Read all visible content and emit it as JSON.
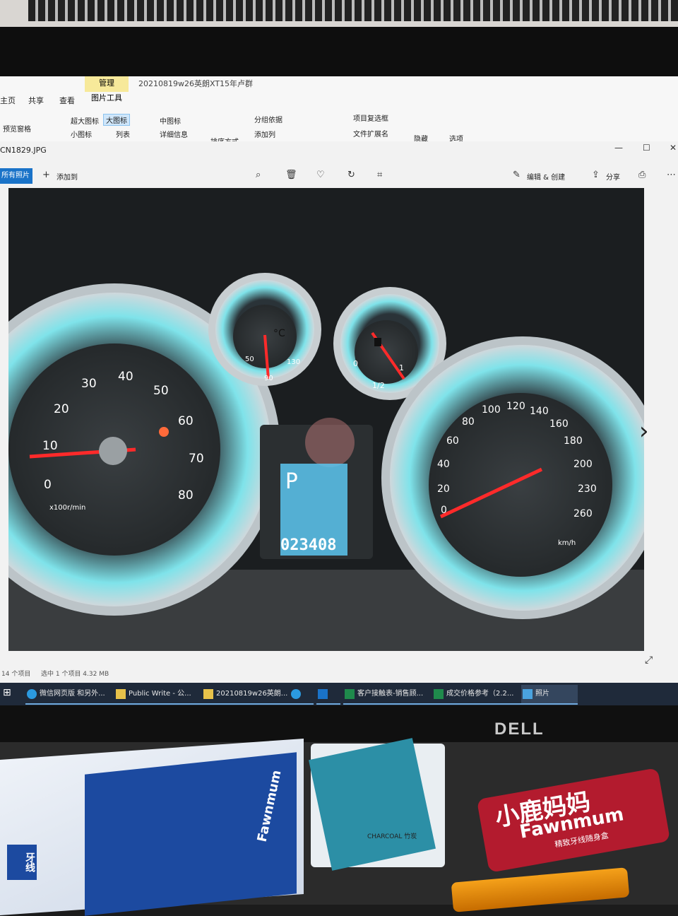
{
  "explorer": {
    "folder_title": "20210819w26英朗XT15年卢群",
    "manage_tab": "管理",
    "picture_tools": "图片工具",
    "tabs": [
      "主页",
      "共享",
      "查看"
    ],
    "layout_options": [
      "超大图标",
      "大图标",
      "中图标",
      "小图标",
      "列表",
      "详细信息"
    ],
    "selected_layout": "大图标",
    "preview_pane": "预览窗格",
    "sort_by": "排序方式",
    "group_by": "分组依据",
    "add_column": "添加列",
    "item_checkboxes": "项目复选框",
    "file_extensions": "文件扩展名",
    "hide": "隐藏",
    "options": "选项"
  },
  "viewer": {
    "file_name": "CN1829.JPG",
    "all_photos": "所有照片",
    "add_to": "添加到",
    "edit_create": "编辑 & 创建",
    "share": "分享",
    "icons": [
      "zoom-icon",
      "delete-icon",
      "heart-icon",
      "rotate-icon",
      "crop-icon",
      "print-icon",
      "more-icon"
    ]
  },
  "dashboard": {
    "tachometer_ticks": [
      "0",
      "10",
      "20",
      "30",
      "40",
      "50",
      "60",
      "70",
      "80"
    ],
    "tachometer_unit": "x100r/min",
    "temp_labels": [
      "50",
      "90",
      "130"
    ],
    "temp_unit": "°C",
    "fuel_labels": [
      "0",
      "1/2",
      "1"
    ],
    "speed_ticks": [
      "0",
      "20",
      "40",
      "60",
      "80",
      "100",
      "120",
      "140",
      "160",
      "180",
      "200",
      "230",
      "260"
    ],
    "speed_unit": "km/h",
    "gear": "P",
    "odometer": "023408"
  },
  "statusbar": {
    "item_count": "14 个项目",
    "selection": "选中 1 个项目  4.32 MB"
  },
  "taskbar": {
    "items": [
      "微信网页版 和另外...",
      "Public Write - 公...",
      "20210819w26英朗...",
      "",
      "",
      "客户接触表-销售顾...",
      "成交价格参考（2.2...",
      "照片"
    ]
  },
  "monitor": {
    "brand": "DELL"
  },
  "desk": {
    "bag_brand": "Fawnmum",
    "bag_label": "牙线",
    "floss_text": "CHARCOAL 竹炭",
    "tin_cn": "小鹿妈妈",
    "tin_en": "Fawnmum",
    "tin_sub": "精致牙线随身盒"
  },
  "colors": {
    "needle": "#ff2a2a",
    "gauge_glow": "#7fe3ea",
    "lcd": "#5cc6f0",
    "accent": "#1a73c8"
  }
}
